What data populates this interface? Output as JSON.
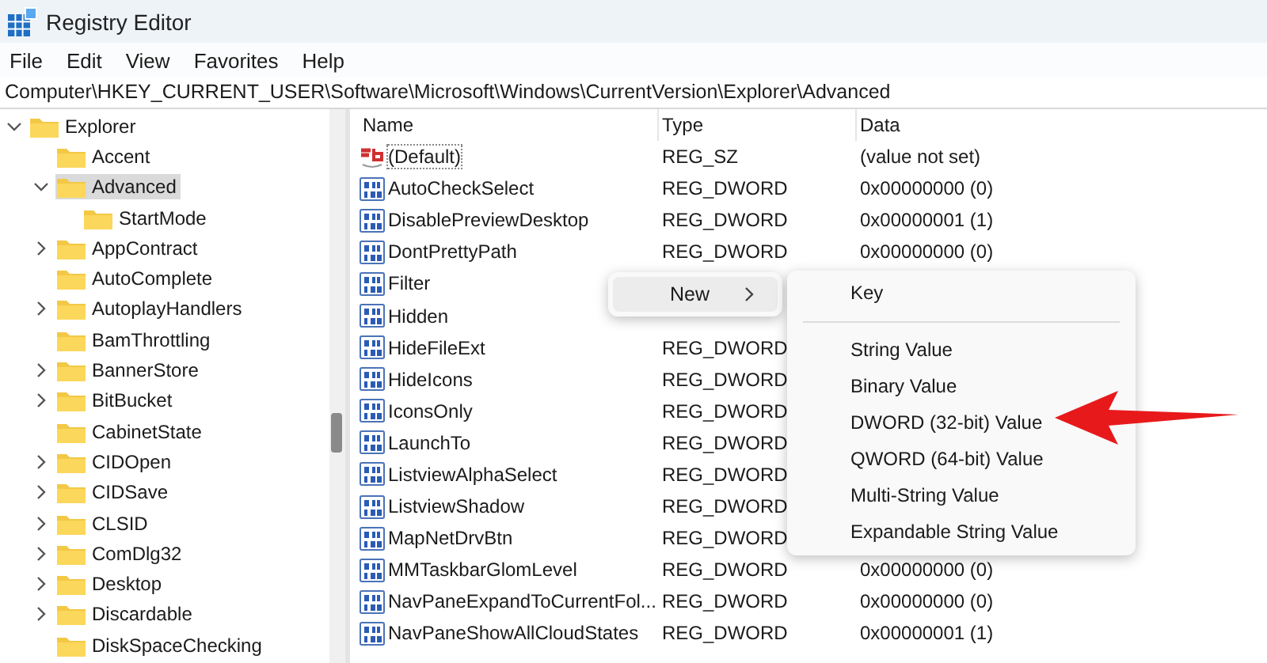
{
  "window": {
    "title": "Registry Editor"
  },
  "menu_bar": [
    "File",
    "Edit",
    "View",
    "Favorites",
    "Help"
  ],
  "address_bar": "Computer\\HKEY_CURRENT_USER\\Software\\Microsoft\\Windows\\CurrentVersion\\Explorer\\Advanced",
  "tree": [
    {
      "label": "Explorer",
      "expanded": true,
      "selected": false,
      "children": [
        {
          "label": "Accent",
          "selected": false
        },
        {
          "label": "Advanced",
          "expanded": true,
          "selected": true,
          "children": [
            {
              "label": "StartMode",
              "selected": false
            }
          ]
        },
        {
          "label": "AppContract",
          "expanded": false,
          "selected": false
        },
        {
          "label": "AutoComplete",
          "selected": false
        },
        {
          "label": "AutoplayHandlers",
          "expanded": false,
          "selected": false
        },
        {
          "label": "BamThrottling",
          "selected": false
        },
        {
          "label": "BannerStore",
          "expanded": false,
          "selected": false
        },
        {
          "label": "BitBucket",
          "expanded": false,
          "selected": false
        },
        {
          "label": "CabinetState",
          "selected": false
        },
        {
          "label": "CIDOpen",
          "expanded": false,
          "selected": false
        },
        {
          "label": "CIDSave",
          "expanded": false,
          "selected": false
        },
        {
          "label": "CLSID",
          "expanded": false,
          "selected": false
        },
        {
          "label": "ComDlg32",
          "expanded": false,
          "selected": false
        },
        {
          "label": "Desktop",
          "expanded": false,
          "selected": false
        },
        {
          "label": "Discardable",
          "expanded": false,
          "selected": false
        },
        {
          "label": "DiskSpaceChecking",
          "selected": false
        }
      ]
    }
  ],
  "values": {
    "columns": [
      "Name",
      "Type",
      "Data"
    ],
    "rows": [
      {
        "kind": "string",
        "name": "(Default)",
        "type": "REG_SZ",
        "data": "(value not set)"
      },
      {
        "kind": "dword",
        "name": "AutoCheckSelect",
        "type": "REG_DWORD",
        "data": "0x00000000 (0)"
      },
      {
        "kind": "dword",
        "name": "DisablePreviewDesktop",
        "type": "REG_DWORD",
        "data": "0x00000001 (1)"
      },
      {
        "kind": "dword",
        "name": "DontPrettyPath",
        "type": "REG_DWORD",
        "data": "0x00000000 (0)"
      },
      {
        "kind": "dword",
        "name": "Filter"
      },
      {
        "kind": "dword",
        "name": "Hidden"
      },
      {
        "kind": "dword",
        "name": "HideFileExt",
        "type": "REG_DWORD"
      },
      {
        "kind": "dword",
        "name": "HideIcons",
        "type": "REG_DWORD"
      },
      {
        "kind": "dword",
        "name": "IconsOnly",
        "type": "REG_DWORD"
      },
      {
        "kind": "dword",
        "name": "LaunchTo",
        "type": "REG_DWORD"
      },
      {
        "kind": "dword",
        "name": "ListviewAlphaSelect",
        "type": "REG_DWORD"
      },
      {
        "kind": "dword",
        "name": "ListviewShadow",
        "type": "REG_DWORD"
      },
      {
        "kind": "dword",
        "name": "MapNetDrvBtn",
        "type": "REG_DWORD"
      },
      {
        "kind": "dword",
        "name": "MMTaskbarGlomLevel",
        "type": "REG_DWORD",
        "data": "0x00000000 (0)"
      },
      {
        "kind": "dword",
        "name": "NavPaneExpandToCurrentFol...",
        "type": "REG_DWORD",
        "data": "0x00000000 (0)"
      },
      {
        "kind": "dword",
        "name": "NavPaneShowAllCloudStates",
        "type": "REG_DWORD",
        "data": "0x00000001 (1)"
      }
    ]
  },
  "context_menu": {
    "items": [
      {
        "label": "New",
        "selected": true
      }
    ],
    "submenu": [
      {
        "kind": "item",
        "label": "Key"
      },
      {
        "kind": "separator"
      },
      {
        "kind": "item",
        "label": "String Value"
      },
      {
        "kind": "item",
        "label": "Binary Value"
      },
      {
        "kind": "item",
        "label": "DWORD (32-bit) Value"
      },
      {
        "kind": "item",
        "label": "QWORD (64-bit) Value"
      },
      {
        "kind": "item",
        "label": "Multi-String Value"
      },
      {
        "kind": "item",
        "label": "Expandable String Value"
      }
    ]
  }
}
